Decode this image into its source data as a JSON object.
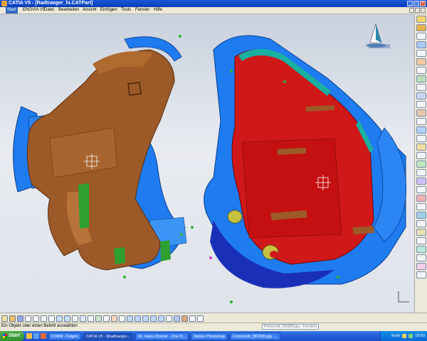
{
  "window": {
    "title": "CATIA V5 - [Radtraeger_hi.CATPart]"
  },
  "menu": [
    {
      "label": "Start"
    },
    {
      "label": "ENOVIA V5"
    },
    {
      "label": "Datei"
    },
    {
      "label": "Bearbeiten"
    },
    {
      "label": "Ansicht"
    },
    {
      "label": "Einfügen"
    },
    {
      "label": "Tools"
    },
    {
      "label": "Fenster"
    },
    {
      "label": "Hilfe"
    }
  ],
  "status": {
    "prompt": "Ein Objekt oder einen Befehl auswählen",
    "command_placeholder": "Portschritt_080308.jpg - Fenstern"
  },
  "taskbar": {
    "start_label": "Start",
    "tasks": [
      {
        "label": "FORM - Felgen"
      },
      {
        "label": "CATIA V5 - [Radtraeger..."
      },
      {
        "label": "34. Hans Zimmer - One D..."
      },
      {
        "label": "Adobe Photoshop"
      },
      {
        "label": "Fortschritt_080308.jpg -..."
      }
    ],
    "tray_text": "Tools",
    "clock": "18:03"
  },
  "viewport": {
    "compass_label": "",
    "axis_label": "",
    "colors": {
      "blue": "#1e7bf0",
      "brown": "#9c5a28",
      "red": "#d01818",
      "dark_blue": "#1a2fb8",
      "green": "#2fa030",
      "teal": "#1ab0a0"
    }
  }
}
